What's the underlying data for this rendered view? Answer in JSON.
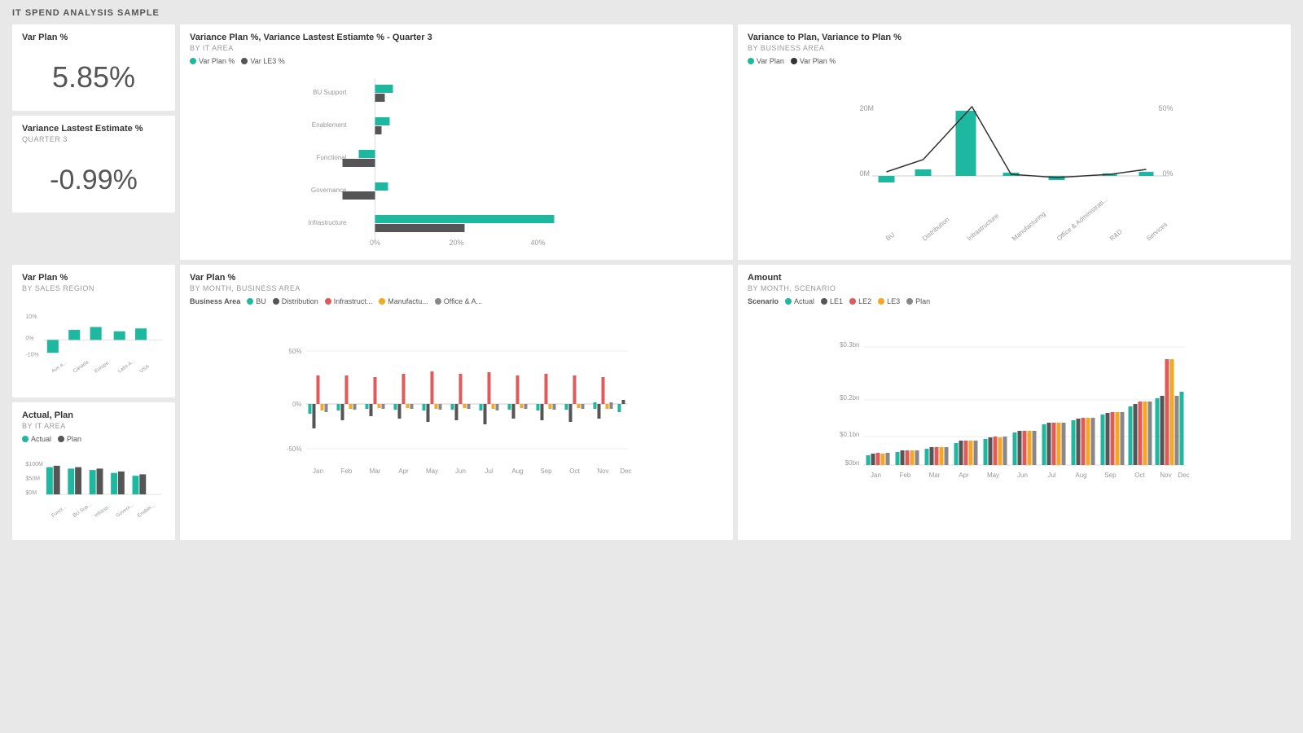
{
  "title": "IT SPEND ANALYSIS SAMPLE",
  "cards": {
    "var_plan_pct": {
      "title": "Var Plan %",
      "value": "5.85%"
    },
    "var_lastest_estimate": {
      "title": "Variance Lastest Estimate %",
      "subtitle": "QUARTER 3",
      "value": "-0.99%"
    },
    "var_plan_q3": {
      "title": "Variance Plan %, Variance Lastest Estiamte % - Quarter 3",
      "subtitle": "BY IT AREA",
      "legend": [
        {
          "label": "Var Plan %",
          "color": "#1EB8A0"
        },
        {
          "label": "Var LE3 %",
          "color": "#555"
        }
      ]
    },
    "variance_to_plan": {
      "title": "Variance to Plan, Variance to Plan %",
      "subtitle": "BY BUSINESS AREA",
      "legend": [
        {
          "label": "Var Plan",
          "color": "#1EB8A0"
        },
        {
          "label": "Var Plan %",
          "color": "#333"
        }
      ]
    },
    "var_plan_region": {
      "title": "Var Plan %",
      "subtitle": "BY SALES REGION"
    },
    "actual_plan": {
      "title": "Actual, Plan",
      "subtitle": "BY IT AREA",
      "legend": [
        {
          "label": "Actual",
          "color": "#1EB8A0"
        },
        {
          "label": "Plan",
          "color": "#555"
        }
      ]
    },
    "var_plan_month": {
      "title": "Var Plan %",
      "subtitle": "BY MONTH, BUSINESS AREA",
      "legend_title": "Business Area",
      "legend": [
        {
          "label": "BU",
          "color": "#1EB8A0"
        },
        {
          "label": "Distribution",
          "color": "#555"
        },
        {
          "label": "Infrastruct...",
          "color": "#E05A5A"
        },
        {
          "label": "Manufactu...",
          "color": "#F5A623"
        },
        {
          "label": "Office & A...",
          "color": "#888"
        }
      ]
    },
    "amount": {
      "title": "Amount",
      "subtitle": "BY MONTH, SCENARIO",
      "legend_title": "Scenario",
      "legend": [
        {
          "label": "Actual",
          "color": "#1EB8A0"
        },
        {
          "label": "LE1",
          "color": "#555"
        },
        {
          "label": "LE2",
          "color": "#E05A5A"
        },
        {
          "label": "LE3",
          "color": "#E8A045"
        },
        {
          "label": "Plan",
          "color": "#666"
        }
      ]
    }
  },
  "months": [
    "Jan",
    "Feb",
    "Mar",
    "Apr",
    "May",
    "Jun",
    "Jul",
    "Aug",
    "Sep",
    "Oct",
    "Nov",
    "Dec"
  ],
  "regions": [
    "Aus a...",
    "Canada",
    "Europe",
    "Latin A...",
    "USA"
  ],
  "it_areas": [
    "Funct...",
    "BU Sup...",
    "Infrastr...",
    "Govern...",
    "Enable..."
  ],
  "business_areas_q3": [
    "BU Support",
    "Enablement",
    "Functional",
    "Governance",
    "Infrastructure"
  ],
  "business_areas_variance": [
    "BU",
    "Distribution",
    "Infrastructure",
    "Manufacturing",
    "Office & Administrati...",
    "R&D",
    "Services"
  ]
}
